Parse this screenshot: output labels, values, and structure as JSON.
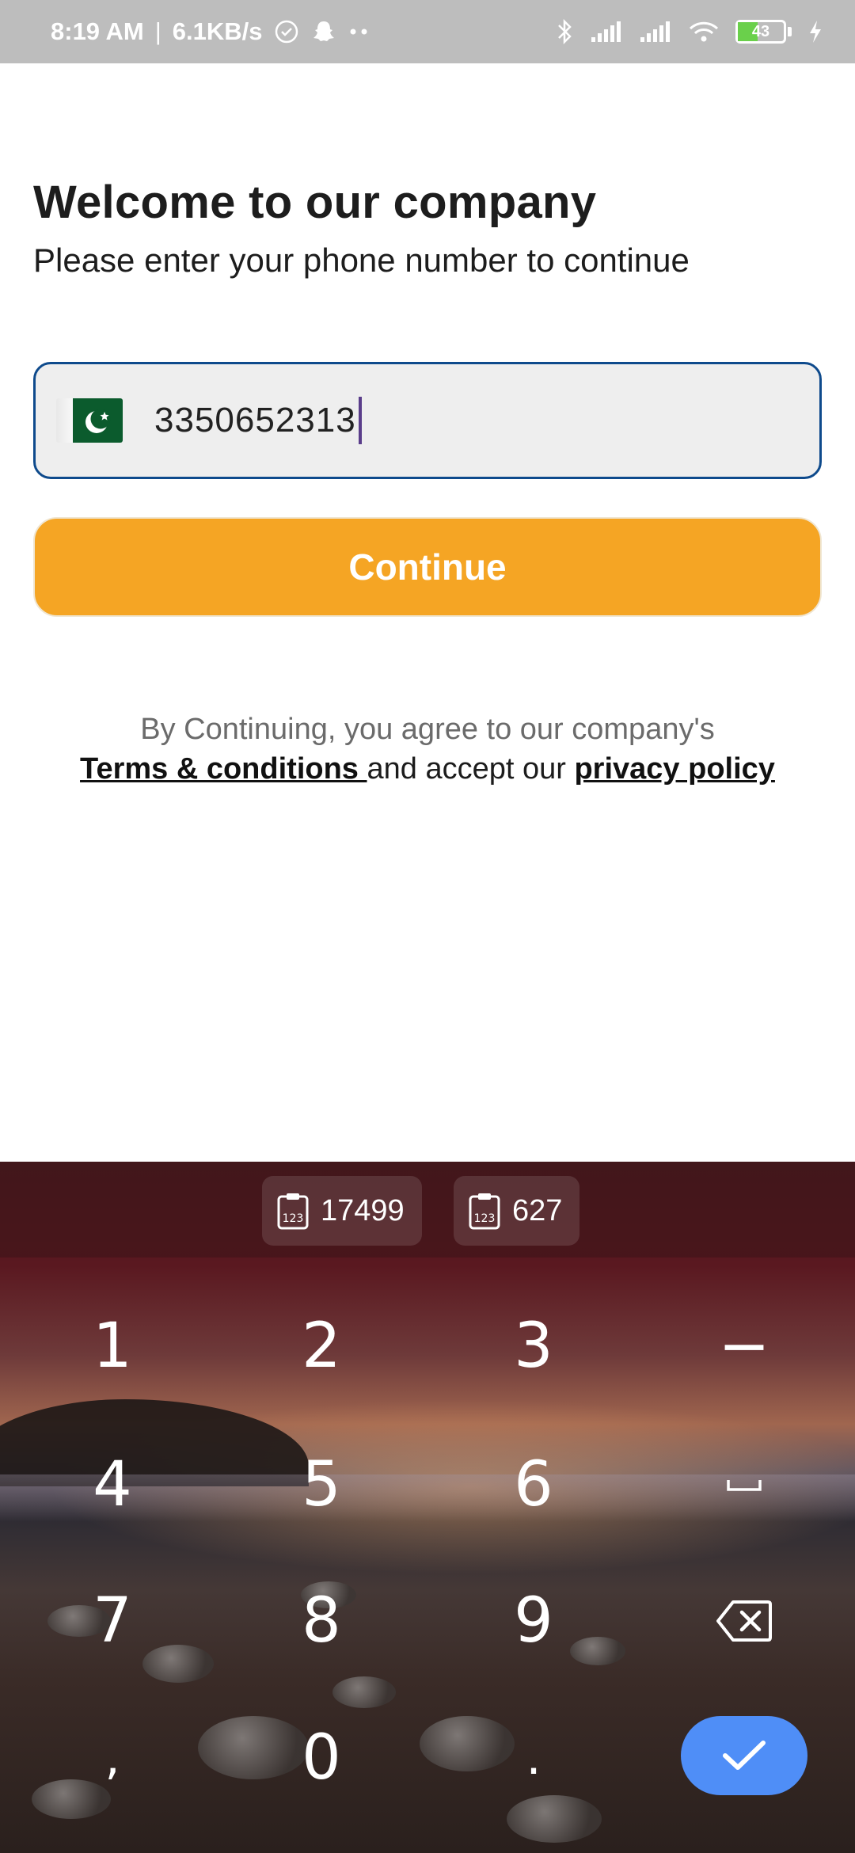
{
  "status_bar": {
    "time": "8:19 AM",
    "separator": "|",
    "speed": "6.1KB/s",
    "battery": "43",
    "icons": [
      "check-circle-icon",
      "snapchat-ghost-icon",
      "more-dots-icon",
      "bluetooth-icon",
      "signal-icon",
      "signal-icon",
      "wifi-icon",
      "battery-icon",
      "charging-bolt-icon"
    ]
  },
  "header": {
    "title": "Welcome to our company",
    "subtitle": "Please enter your phone number to continue"
  },
  "phone_input": {
    "country_flag": "pakistan-flag-icon",
    "value": "3350652313"
  },
  "continue_button": {
    "label": "Continue",
    "color": "#f5a524"
  },
  "terms": {
    "line1": "By Continuing, you agree to our company's",
    "terms_link": "Terms & conditions ",
    "middle": "and accept our ",
    "privacy_link": "privacy policy"
  },
  "keyboard": {
    "clipboard": [
      "17499",
      "627"
    ],
    "keys": {
      "k1": "1",
      "k2": "2",
      "k3": "3",
      "minus": "−",
      "k4": "4",
      "k5": "5",
      "k6": "6",
      "k7": "7",
      "k8": "8",
      "k9": "9",
      "comma": ",",
      "k0": "0",
      "dot": "."
    },
    "accent": "#4f8ef7"
  }
}
